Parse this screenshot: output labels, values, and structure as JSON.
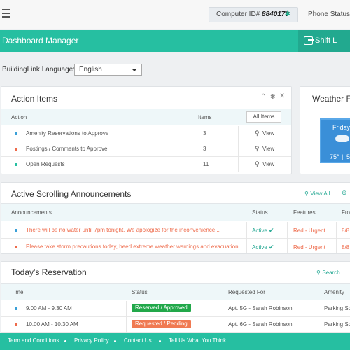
{
  "topbar": {
    "computer_id_label": "Computer ID#",
    "computer_id_value": "8840179",
    "phone_status": "Phone Status"
  },
  "header": {
    "title": "Dashboard Manager",
    "shift_tab": "Shift L"
  },
  "language": {
    "label": "BuildingLink Language:",
    "selected": "English"
  },
  "action_items": {
    "title": "Action Items",
    "col_action": "Action",
    "col_items": "Items",
    "all_items": "All Items",
    "rows": [
      {
        "label": "Amenity Reservations to Approve",
        "count": "3",
        "view": "View",
        "color": "#3aa0d8"
      },
      {
        "label": "Postings / Comments to Approve",
        "count": "3",
        "view": "View",
        "color": "#ee6a4a"
      },
      {
        "label": "Open Requests",
        "count": "11",
        "view": "View",
        "color": "#26bfa1"
      }
    ]
  },
  "weather": {
    "title": "Weather Fo",
    "day": "Friday",
    "temp_high": "75°",
    "temp_low": "5"
  },
  "announcements": {
    "title": "Active Scrolling Announcements",
    "view_all": "View All",
    "col_announcements": "Announcements",
    "col_status": "Status",
    "col_features": "Features",
    "col_from": "Fro",
    "rows": [
      {
        "text": "There will be no water until 7pm tonight. We apologize for the inconvenience...",
        "status": "Active",
        "feature": "Red - Urgent",
        "from": "8/8",
        "color": "#3aa0d8"
      },
      {
        "text": "Please take storm precautions today, heed extreme weather warnings and evacuation...",
        "status": "Active",
        "feature": "Red - Urgent",
        "from": "8/8",
        "color": "#ee6a4a"
      }
    ]
  },
  "reservation": {
    "title": "Today's Reservation",
    "search": "Search",
    "col_time": "Time",
    "col_status": "Status",
    "col_requested": "Requested For",
    "col_amenity": "Amenity",
    "rows": [
      {
        "time": "9.00 AM - 9.30 AM",
        "status": "Reserved / Approved",
        "status_color": "#22a84a",
        "requested": "Apt. 5G - Sarah Robinson",
        "amenity": "Parking Spa",
        "color": "#3aa0d8"
      },
      {
        "time": "10.00 AM - 10.30 AM",
        "status": "Requested / Pending",
        "status_color": "#f07a52",
        "requested": "Apt. 6G - Sarah Robinson",
        "amenity": "Parking Spa",
        "color": "#ee6a4a"
      }
    ]
  },
  "footer": {
    "terms": "Term and Conditions",
    "privacy": "Privacy Policy",
    "contact": "Contact Us",
    "tell": "Tell Us What You Think"
  },
  "colors": {
    "accent": "#26bfa1",
    "urgent": "#ee6a4a"
  }
}
